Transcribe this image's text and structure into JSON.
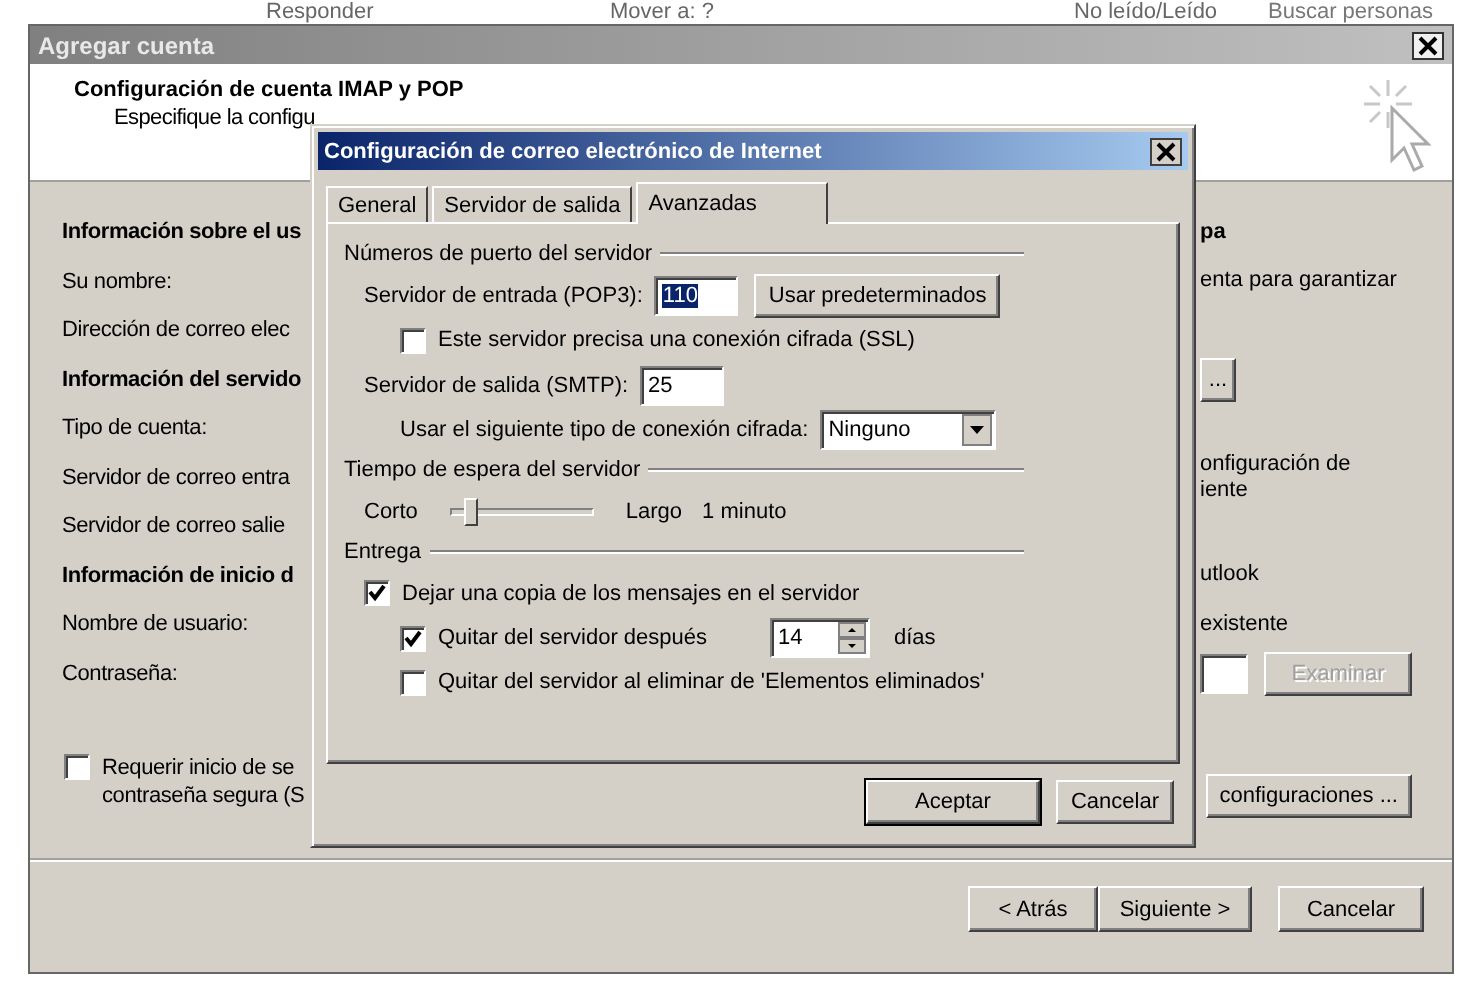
{
  "background_toolbar": {
    "items": [
      {
        "label": "Responder"
      },
      {
        "label": "Mover a: ?"
      },
      {
        "label": "No leído/Leído"
      }
    ],
    "search": {
      "placeholder": "Buscar personas"
    }
  },
  "account_dialog": {
    "title": "Agregar cuenta",
    "heading": "Configuración de cuenta IMAP y POP",
    "subheading": "Especifique la configu",
    "rows": [
      {
        "left": {
          "text": "Información sobre el us",
          "kind": "heading"
        },
        "right": {
          "kind": "heading",
          "lines": [
            "pa"
          ]
        }
      },
      {
        "left": {
          "text": "Su nombre:",
          "kind": "label"
        },
        "right": {
          "kind": "text",
          "lines": [
            "enta para garantizar"
          ]
        }
      },
      {
        "left": {
          "text": "Dirección de correo elec",
          "kind": "label"
        }
      },
      {
        "left": {
          "text": "Información del servido",
          "kind": "heading"
        },
        "right": {
          "kind": "button",
          "label": "..."
        }
      },
      {
        "left": {
          "text": "Tipo de cuenta:",
          "kind": "label"
        }
      },
      {
        "left": {
          "text": "Servidor de correo entra",
          "kind": "label"
        },
        "right": {
          "kind": "text",
          "lines": [
            "onfiguración de",
            "iente"
          ]
        }
      },
      {
        "left": {
          "text": "Servidor de correo salie",
          "kind": "label"
        }
      },
      {
        "left": {
          "text": "Información de inicio d",
          "kind": "heading"
        },
        "right": {
          "kind": "text",
          "lines": [
            "utlook"
          ]
        }
      },
      {
        "left": {
          "text": "Nombre de usuario:",
          "kind": "label"
        },
        "right": {
          "kind": "text",
          "lines": [
            "existente"
          ]
        }
      },
      {
        "left": {
          "text": "Contraseña:",
          "kind": "label"
        },
        "right": {
          "kind": "browse",
          "label": "Examinar",
          "disabled": true
        }
      }
    ],
    "require_spa": {
      "lines": [
        "Requerir inicio de se",
        "contraseña segura (S"
      ],
      "checked": false
    },
    "more_settings": {
      "label": "configuraciones ..."
    },
    "buttons": [
      {
        "label": "< Atrás"
      },
      {
        "label": "Siguiente >"
      },
      {
        "label": "Cancelar"
      }
    ]
  },
  "internet_dialog": {
    "title": "Configuración de correo electrónico de Internet",
    "tabs": [
      {
        "label": "General",
        "selected": false
      },
      {
        "label": "Servidor de salida",
        "selected": false
      },
      {
        "label": "Avanzadas",
        "selected": true
      }
    ],
    "ports": {
      "title": "Números de puerto del servidor",
      "incoming_label": "Servidor de entrada (POP3):",
      "incoming_value": "110",
      "defaults_button": "Usar predeterminados",
      "ssl": {
        "label": "Este servidor precisa una conexión cifrada (SSL)",
        "checked": false
      },
      "outgoing_label": "Servidor de salida (SMTP):",
      "outgoing_value": "25",
      "encryption_label": "Usar el siguiente tipo de conexión cifrada:",
      "encryption_value": "Ninguno"
    },
    "timeout": {
      "title": "Tiempo de espera del servidor",
      "min_label": "Corto",
      "max_label": "Largo",
      "level": 0.1,
      "reading": "1 minuto"
    },
    "delivery": {
      "title": "Entrega",
      "leave_copy": {
        "label": "Dejar una copia de los mensajes en el servidor",
        "checked": true
      },
      "remove_after": {
        "label": "Quitar del servidor después",
        "checked": true,
        "days": "14",
        "unit": "días"
      },
      "remove_deleted": {
        "label": "Quitar del servidor al eliminar de 'Elementos eliminados'",
        "checked": false
      }
    },
    "buttons": [
      {
        "label": "Aceptar",
        "default": true
      },
      {
        "label": "Cancelar",
        "default": false
      }
    ]
  }
}
